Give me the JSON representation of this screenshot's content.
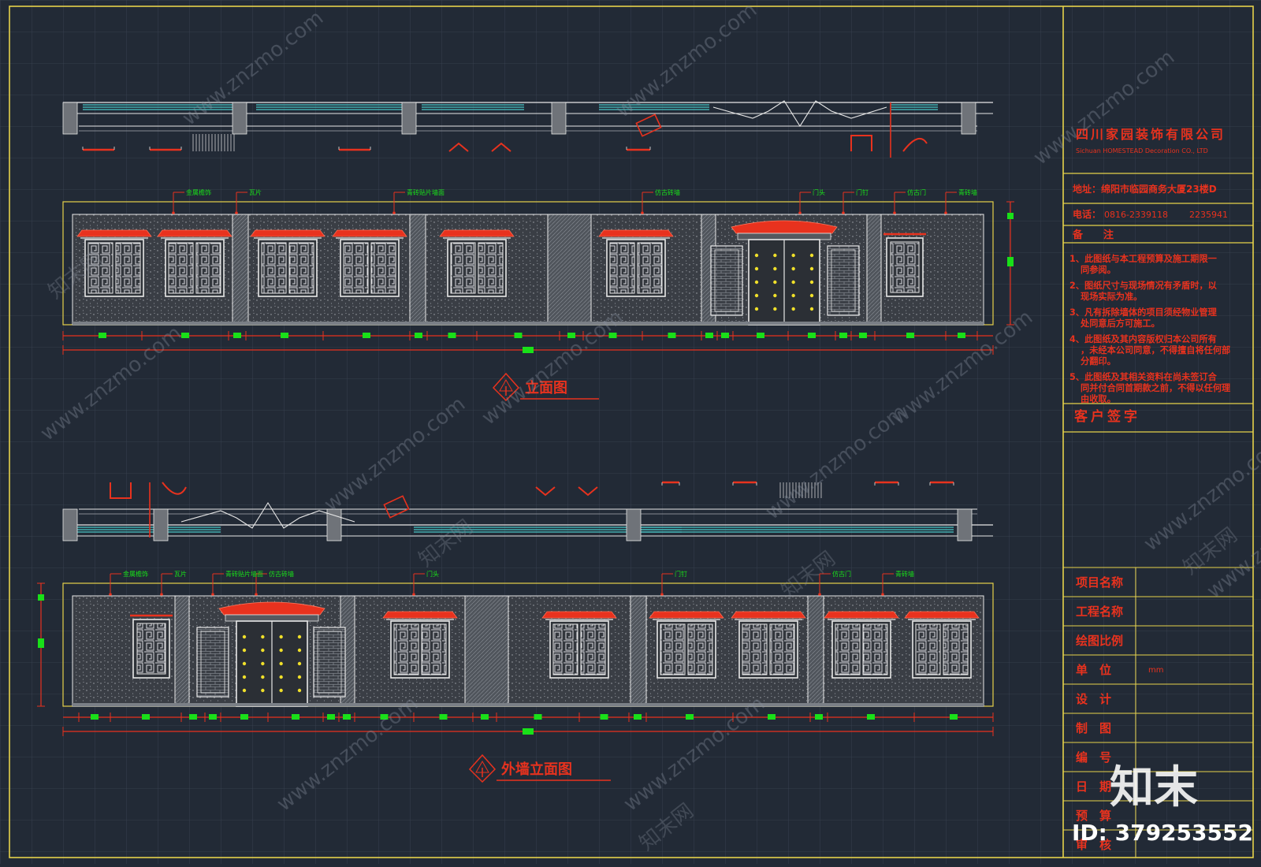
{
  "colors": {
    "background": "#222a36",
    "grid": "#3a4452",
    "frame": "#e6d24a",
    "accent_red": "#e8321e",
    "accent_green": "#19e019",
    "accent_cyan": "#49c6c8",
    "line_white": "#e8e8e8",
    "wall_fill": "#3d4148"
  },
  "title_block": {
    "company_name": "四川家园装饰有限公司",
    "company_name_en": "Sichuan HOMESTEAD Decoration CO., LTD",
    "address": "地址：绵阳市临园商务大厦23楼D",
    "phone_label": "电话：",
    "phone_1": "0816-2339118",
    "phone_2": "2235941",
    "notes_heading": "备　　注",
    "notes": [
      "1、此图纸与本工程预算及施工期限一同参阅。",
      "2、图纸尺寸与现场情况有矛盾时，以现场实际为准。",
      "3、凡有拆除墙体的项目须经物业管理处同意后方可施工。",
      "4、此图纸及其内容版权归本公司所有，未经本公司同意，不得擅自将任何部分翻印。",
      "5、此图纸及其相关资料在尚未签订合同并付合同首期款之前，不得以任何理由收取。"
    ],
    "client_signature": "客户签字",
    "fields": [
      {
        "label": "项目名称",
        "value": ""
      },
      {
        "label": "工程名称",
        "value": ""
      },
      {
        "label": "绘图比例",
        "value": ""
      },
      {
        "label": "单　位",
        "value": "mm"
      },
      {
        "label": "设　计",
        "value": ""
      },
      {
        "label": "制　图",
        "value": ""
      },
      {
        "label": "编　号",
        "value": ""
      },
      {
        "label": "日　期",
        "value": ""
      },
      {
        "label": "预　算",
        "value": ""
      },
      {
        "label": "审　核",
        "value": ""
      }
    ]
  },
  "drawings": {
    "elevation_1": {
      "title": "立面图",
      "leaders": [
        "金属檐饰",
        "瓦片",
        "青砖贴片墙面",
        "仿古砖墙",
        "门头",
        "门钉",
        "仿古门",
        "青砖墙"
      ]
    },
    "elevation_2": {
      "title": "外墙立面图",
      "leaders": [
        "青砖墙",
        "仿古门",
        "门钉",
        "门头",
        "仿古砖墙",
        "青砖贴片墙面",
        "瓦片",
        "金属檐饰"
      ]
    }
  },
  "watermark": {
    "site": "www.znzmo.com",
    "brand": "知末网",
    "logo_text": "知末",
    "id_text": "ID: 379253552"
  }
}
